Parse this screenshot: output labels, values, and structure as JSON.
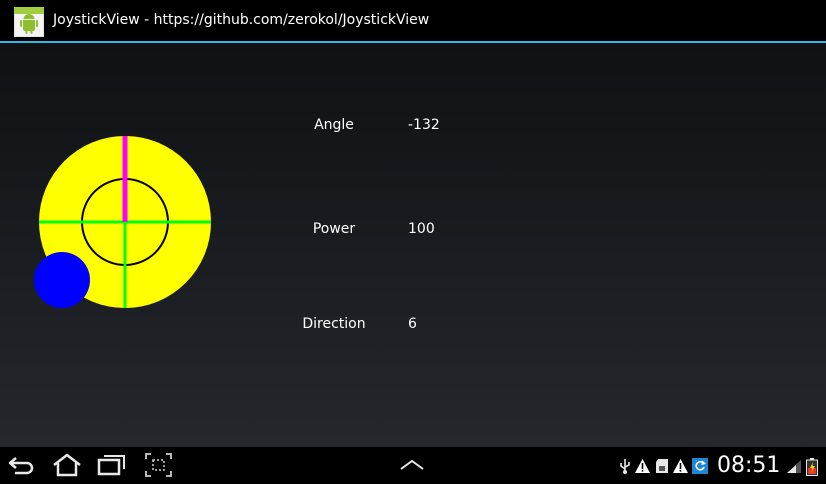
{
  "window": {
    "title": "JoystickView - https://github.com/zerokol/JoystickView"
  },
  "readouts": {
    "angle": {
      "label": "Angle",
      "value": "-132"
    },
    "power": {
      "label": "Power",
      "value": "100"
    },
    "direction": {
      "label": "Direction",
      "value": "6"
    }
  },
  "joystick": {
    "base_color": "#ffff00",
    "ring_color": "#000000",
    "axis_color": "#00ff00",
    "up_button_color": "#ff00ff",
    "handle_color": "#0000ff"
  },
  "status_bar": {
    "time": "08:51",
    "icons": [
      "usb-icon",
      "warning-icon",
      "sd-card-icon",
      "warning-icon",
      "sync-icon",
      "signal-icon",
      "battery-icon"
    ]
  },
  "navigation": {
    "buttons": [
      "back-icon",
      "home-icon",
      "recent-apps-icon",
      "screenshot-icon",
      "menu-chevron-up-icon"
    ]
  },
  "colors": {
    "accent": "#33b5e5",
    "warning_bg": "#ffffff"
  }
}
